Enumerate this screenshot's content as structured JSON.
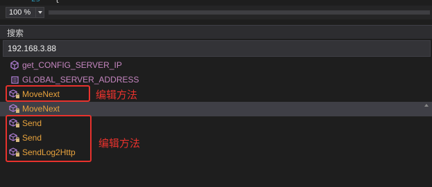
{
  "editor": {
    "line_number": "25",
    "code_text": "{"
  },
  "zoom": {
    "value": "100 %"
  },
  "search_panel": {
    "title": "搜索",
    "search_value": "192.168.3.88",
    "results": [
      {
        "label": "get_CONFIG_SERVER_IP",
        "icon": "method-icon",
        "color": "#c586c0"
      },
      {
        "label": "GLOBAL_SERVER_ADDRESS",
        "icon": "field-icon",
        "color": "#c586c0"
      },
      {
        "label": "MoveNext",
        "icon": "private-method-icon",
        "color": "#e8a33d"
      },
      {
        "label": "MoveNext",
        "icon": "private-method-icon",
        "color": "#e8a33d"
      },
      {
        "label": "Send",
        "icon": "private-method-icon",
        "color": "#e8a33d"
      },
      {
        "label": "Send",
        "icon": "private-method-icon",
        "color": "#e8a33d"
      },
      {
        "label": "SendLog2Http",
        "icon": "private-method-icon",
        "color": "#e8a33d"
      }
    ]
  },
  "annotations": [
    {
      "text": "编辑方法"
    },
    {
      "text": "编辑方法"
    }
  ],
  "colors": {
    "accent_red": "#e8322d",
    "public_member": "#c586c0",
    "private_member": "#e8a33d"
  }
}
